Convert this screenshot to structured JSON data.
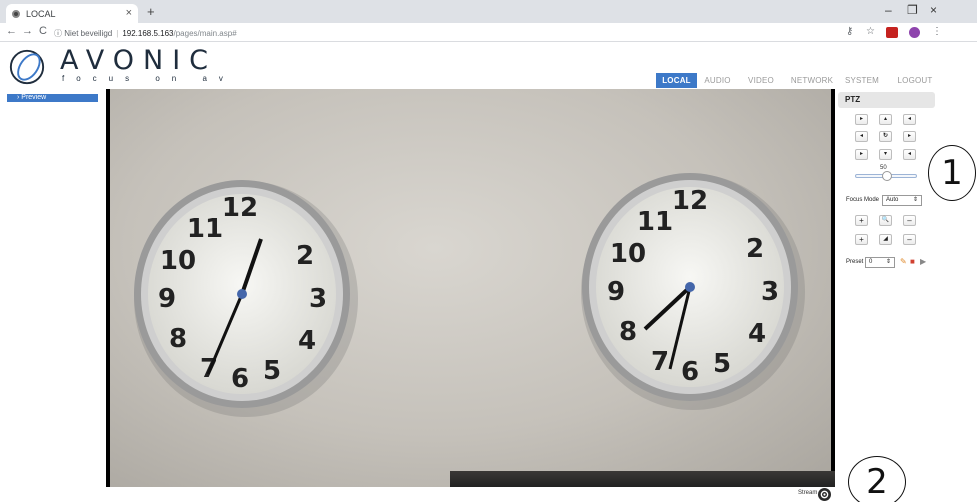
{
  "browser": {
    "tab_title": "LOCAL",
    "tab_close": "×",
    "new_tab": "+",
    "win_min": "–",
    "win_restore": "❐",
    "win_close": "×",
    "back": "←",
    "forward": "→",
    "reload": "C",
    "security_text": "ⓘ Niet beveiligd",
    "url_host": "192.168.5.163",
    "url_path": "/pages/main.asp#",
    "key_icon": "⚷",
    "star": "☆",
    "menu": "⋮"
  },
  "app": {
    "brand": "AVONIC",
    "tagline": "focus on av",
    "nav": [
      "LOCAL",
      "AUDIO",
      "VIDEO",
      "NETWORK",
      "SYSTEM",
      "LOGOUT"
    ],
    "active_nav": "LOCAL",
    "accent": "#3d79c8"
  },
  "sidebar": {
    "items": [
      {
        "label": "› Preview"
      }
    ]
  },
  "video": {
    "stream_label": "Stream"
  },
  "ptz": {
    "title": "PTZ",
    "speed_value": "50",
    "focus_mode_label": "Focus Mode",
    "focus_mode_value": "Auto",
    "select_arrow": "⇕",
    "preset_label": "Preset",
    "preset_value": "0",
    "buttons": {
      "up_left": "▸",
      "up": "▴",
      "up_right": "◂",
      "left": "◂",
      "home": "↻",
      "right": "▸",
      "down_left": "▸",
      "down": "▾",
      "down_right": "◂",
      "zoom_in": "+",
      "zoom_icon": "🔍",
      "zoom_out": "–",
      "focus_in": "+",
      "focus_icon": "◢",
      "focus_out": "–"
    }
  },
  "callouts": [
    "1",
    "2"
  ]
}
